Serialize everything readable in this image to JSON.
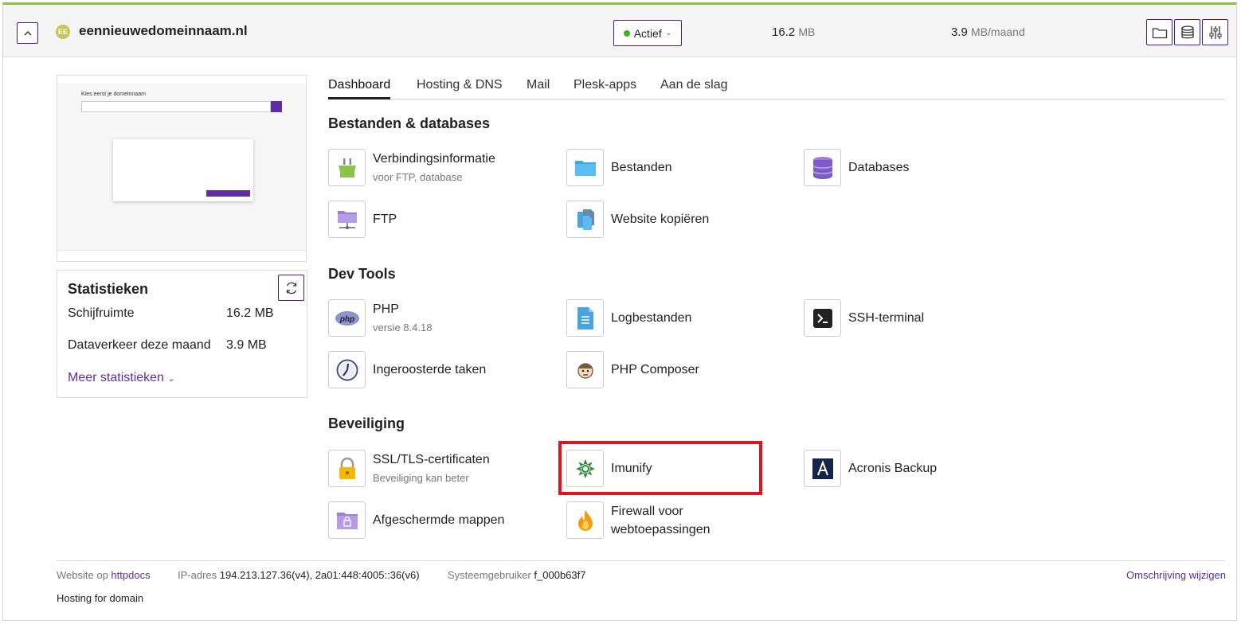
{
  "header": {
    "domain_badge": "EE",
    "domain": "eennieuwedomeinnaam.nl",
    "status": "Actief",
    "disk_value": "16.2",
    "disk_unit": "MB",
    "traffic_value": "3.9",
    "traffic_unit": "MB/maand"
  },
  "stats": {
    "title": "Statistieken",
    "rows": [
      {
        "label": "Schijfruimte",
        "value": "16.2 MB"
      },
      {
        "label": "Dataverkeer deze maand",
        "value": "3.9 MB"
      }
    ],
    "more": "Meer statistieken"
  },
  "tabs": [
    "Dashboard",
    "Hosting & DNS",
    "Mail",
    "Plesk-apps",
    "Aan de slag"
  ],
  "sections": {
    "files": "Bestanden & databases",
    "dev": "Dev Tools",
    "security": "Beveiliging"
  },
  "tiles": {
    "conn_info": {
      "title": "Verbindingsinformatie",
      "sub": "voor FTP, database"
    },
    "files": {
      "title": "Bestanden"
    },
    "databases": {
      "title": "Databases"
    },
    "ftp": {
      "title": "FTP"
    },
    "copy_site": {
      "title": "Website kopiëren"
    },
    "php": {
      "title": "PHP",
      "sub": "versie 8.4.18"
    },
    "logs": {
      "title": "Logbestanden"
    },
    "ssh": {
      "title": "SSH-terminal"
    },
    "cron": {
      "title": "Ingeroosterde taken"
    },
    "composer": {
      "title": "PHP Composer"
    },
    "ssl": {
      "title": "SSL/TLS-certificaten",
      "sub": "Beveiliging kan beter"
    },
    "imunify": {
      "title": "Imunify"
    },
    "acronis": {
      "title": "Acronis Backup"
    },
    "protected": {
      "title": "Afgeschermde mappen"
    },
    "firewall": {
      "title1": "Firewall voor",
      "title2": "webtoepassingen"
    }
  },
  "footer": {
    "website_label": "Website op",
    "website_link": "httpdocs",
    "ip_label": "IP-adres",
    "ip_value": "194.213.127.36(v4), 2a01:448:4005::36(v6)",
    "user_label": "Systeemgebruiker",
    "user_value": "f_000b63f7",
    "edit": "Omschrijving wijzigen",
    "hosting_for": "Hosting for domain"
  },
  "preview": {
    "heading": "Kies eerst je domeinnaam"
  },
  "colors": {
    "accent": "#5e2ca5",
    "status": "#3fae29",
    "highlight": "#e0141e"
  }
}
